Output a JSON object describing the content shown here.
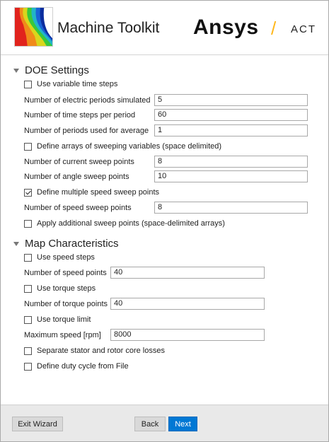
{
  "header": {
    "app_title": "Machine Toolkit",
    "brand": "Ansys",
    "brand_separator": "/",
    "brand_suffix": "ACT",
    "brand_accent": "#ffb71b"
  },
  "doe": {
    "title": "DOE Settings",
    "use_variable_time_steps": {
      "label": "Use variable time steps",
      "checked": false
    },
    "electric_periods": {
      "label": "Number of electric periods simulated",
      "value": "5"
    },
    "time_steps_per_period": {
      "label": "Number of time steps per period",
      "value": "60"
    },
    "periods_for_average": {
      "label": "Number of periods used for average",
      "value": "1"
    },
    "define_sweep_arrays": {
      "label": "Define arrays of sweeping variables (space delimited)",
      "checked": false
    },
    "current_sweep_points": {
      "label": "Number of current sweep points",
      "value": "8"
    },
    "angle_sweep_points": {
      "label": "Number of angle sweep points",
      "value": "10"
    },
    "multiple_speed_sweep": {
      "label": "Define multiple speed sweep points",
      "checked": true
    },
    "speed_sweep_points": {
      "label": "Number of speed sweep points",
      "value": "8"
    },
    "additional_sweep_points": {
      "label": "Apply additional sweep points (space-delimited arrays)",
      "checked": false
    }
  },
  "map": {
    "title": "Map Characteristics",
    "use_speed_steps": {
      "label": "Use speed steps",
      "checked": false
    },
    "speed_points": {
      "label": "Number of speed points",
      "value": "40"
    },
    "use_torque_steps": {
      "label": "Use torque steps",
      "checked": false
    },
    "torque_points": {
      "label": "Number of torque points",
      "value": "40"
    },
    "use_torque_limit": {
      "label": "Use torque limit",
      "checked": false
    },
    "max_speed": {
      "label": "Maximum speed [rpm]",
      "value": "8000"
    },
    "separate_losses": {
      "label": "Separate stator and rotor core losses",
      "checked": false
    },
    "duty_cycle": {
      "label": "Define duty cycle from File",
      "checked": false
    }
  },
  "footer": {
    "exit_label": "Exit Wizard",
    "back_label": "Back",
    "next_label": "Next",
    "next_color": "#0078d4"
  }
}
